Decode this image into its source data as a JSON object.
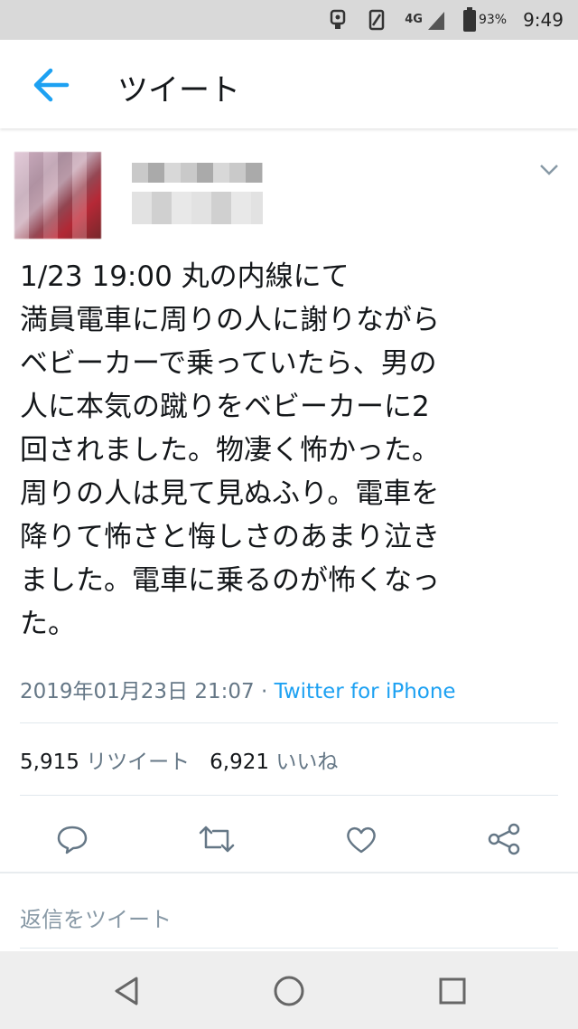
{
  "status_bar": {
    "network": "4G",
    "battery_percent": "93%",
    "time": "9:49"
  },
  "header": {
    "title": "ツイート"
  },
  "tweet": {
    "text": "1/23 19:00 丸の内線にて\n満員電車に周りの人に謝りながら\nベビーカーで乗っていたら、男の\n人に本気の蹴りをベビーカーに2\n回されました。物凄く怖かった。\n周りの人は見て見ぬふり。電車を\n降りて怖さと悔しさのあまり泣き\nました。電車に乗るのが怖くなっ\nた。",
    "timestamp": "2019年01月23日 21:07",
    "separator": " · ",
    "source": "Twitter for iPhone",
    "retweet_count": "5,915",
    "retweet_label": "リツイート",
    "like_count": "6,921",
    "like_label": "いいね"
  },
  "reply": {
    "placeholder": "返信をツイート"
  },
  "colors": {
    "accent": "#1da1f2",
    "text": "#14171a",
    "secondary": "#657786"
  }
}
